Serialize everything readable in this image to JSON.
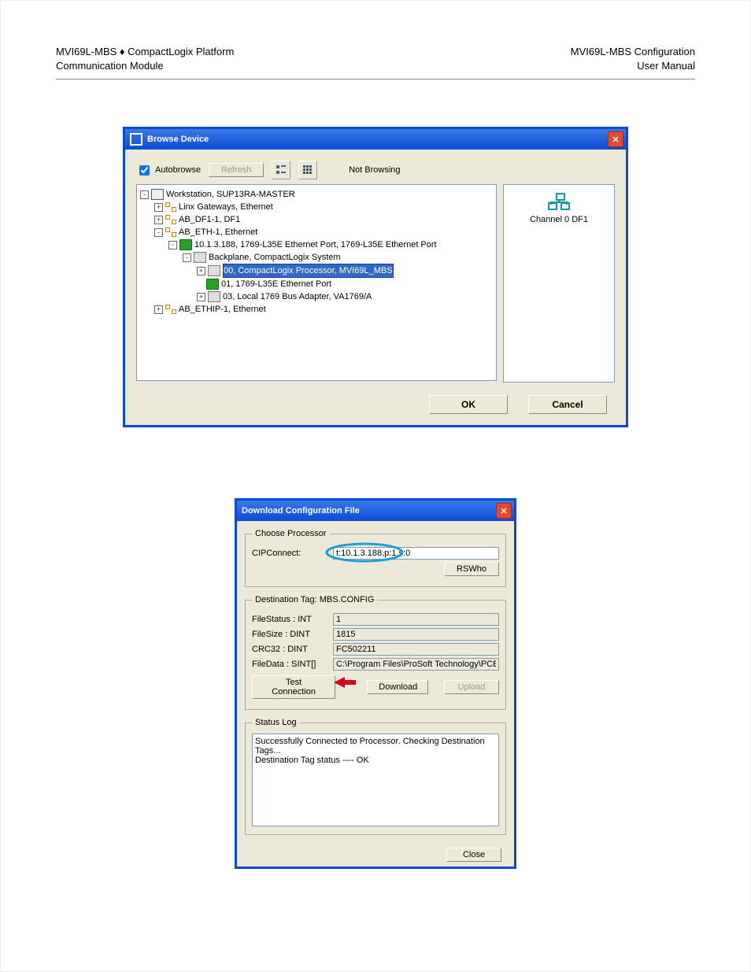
{
  "header": {
    "left_line1": "MVI69L-MBS ♦ CompactLogix Platform",
    "left_line2": "Communication Module",
    "right_line1": "MVI69L-MBS Configuration",
    "right_line2": "User Manual"
  },
  "browse_dialog": {
    "title": "Browse Device",
    "autobrowse_label": "Autobrowse",
    "autobrowse_checked": true,
    "refresh_label": "Refresh",
    "status_text": "Not Browsing",
    "ok_label": "OK",
    "cancel_label": "Cancel",
    "side_panel_caption": "Channel 0 DF1",
    "tree": {
      "root": "Workstation, SUP13RA-MASTER",
      "nodes": [
        {
          "expand": "+",
          "icon": "net",
          "label": "Linx Gateways, Ethernet"
        },
        {
          "expand": "+",
          "icon": "net",
          "label": "AB_DF1-1, DF1"
        },
        {
          "expand": "-",
          "icon": "net",
          "label": "AB_ETH-1, Ethernet"
        }
      ],
      "eth_ip": {
        "expand": "-",
        "icon": "dev",
        "label": "10.1.3.188, 1769-L35E Ethernet Port, 1769-L35E Ethernet Port"
      },
      "backplane": {
        "expand": "-",
        "icon": "bp",
        "label": "Backplane, CompactLogix System"
      },
      "slots": [
        {
          "expand": "+",
          "icon": "bp",
          "label": "00, CompactLogix Processor, MVI69L_MBS",
          "selected": true
        },
        {
          "expand": "",
          "icon": "dev",
          "label": "01, 1769-L35E Ethernet Port"
        },
        {
          "expand": "+",
          "icon": "bp",
          "label": "03, Local 1769 Bus Adapter, VA1769/A"
        }
      ],
      "tail": {
        "expand": "+",
        "icon": "net",
        "label": "AB_ETHIP-1, Ethernet"
      }
    }
  },
  "download_dialog": {
    "title": "Download Configuration File",
    "choose_proc_legend": "Choose Processor",
    "cip_label": "CIPConnect:",
    "cip_value": "t:10.1.3.188,p:1,s:0",
    "rswho_label": "RSWho",
    "dest_legend": "Destination Tag: MBS.CONFIG",
    "rows": {
      "filestatus_k": "FileStatus : INT",
      "filestatus_v": "1",
      "filesize_k": "FileSize   : DINT",
      "filesize_v": "1815",
      "crc32_k": "CRC32    : DINT",
      "crc32_v": "FC502211",
      "filedata_k": "FileData  : SINT[]",
      "filedata_v": "C:\\Program Files\\ProSoft Technology\\PCB\\Prolinx.c"
    },
    "test_conn_label": "Test Connection",
    "download_label": "Download",
    "upload_label": "Upload",
    "status_legend": "Status Log",
    "status_line1": "Successfully Connected to Processor. Checking Destination Tags...",
    "status_line2": "Destination Tag status ---- OK",
    "close_label": "Close"
  }
}
